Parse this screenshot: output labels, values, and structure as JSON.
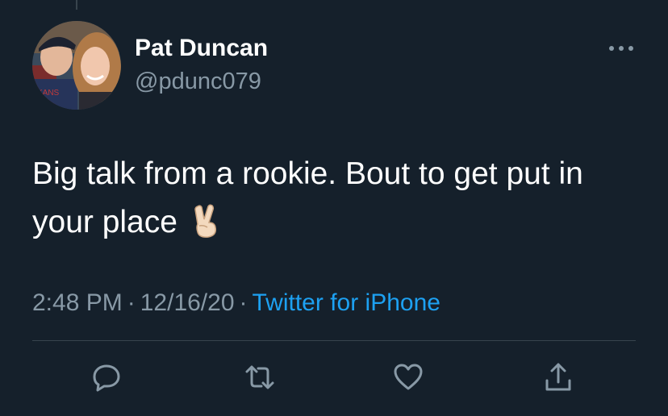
{
  "tweet": {
    "author_name": "Pat Duncan",
    "author_handle": "@pdunc079",
    "text": "Big talk from a rookie. Bout to get put in your place",
    "emoji": "victory-hand-emoji-light-skin-tone",
    "time": "2:48 PM",
    "date": "12/16/20",
    "separator": "·",
    "source": "Twitter for iPhone"
  },
  "actions": [
    {
      "icon": "reply-icon"
    },
    {
      "icon": "retweet-icon"
    },
    {
      "icon": "like-icon"
    },
    {
      "icon": "share-icon"
    }
  ],
  "colors": {
    "background": "#15202b",
    "text_primary": "#ffffff",
    "text_secondary": "#8899a6",
    "link": "#1da1f2",
    "divider": "#38444d"
  }
}
